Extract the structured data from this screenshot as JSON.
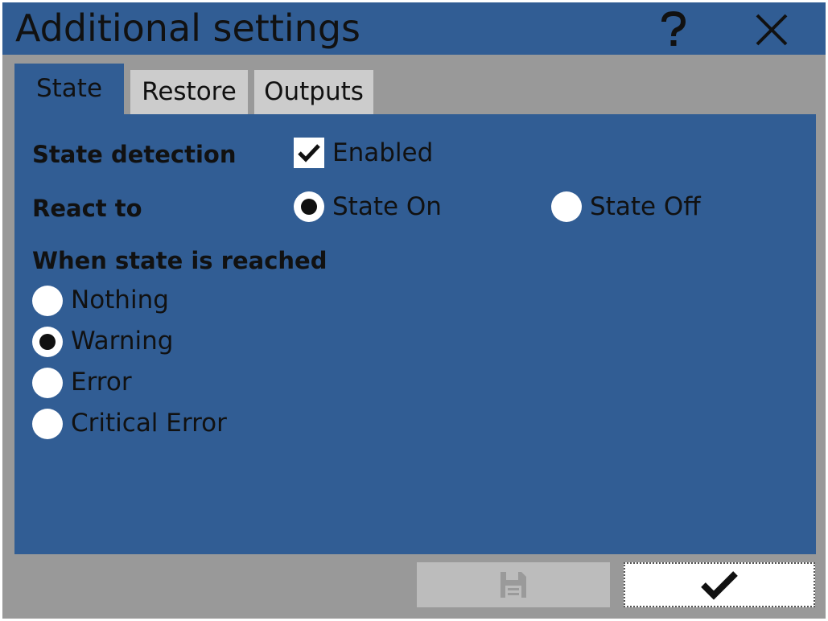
{
  "window": {
    "title": "Additional settings",
    "help_icon": "question-mark-icon",
    "close_icon": "close-x-icon"
  },
  "tabs": [
    {
      "label": "State",
      "active": true
    },
    {
      "label": "Restore",
      "active": false
    },
    {
      "label": "Outputs",
      "active": false
    }
  ],
  "state_tab": {
    "state_detection": {
      "label": "State detection",
      "checkbox_label": "Enabled",
      "checked": true
    },
    "react_to": {
      "label": "React to",
      "options": [
        {
          "label": "State On",
          "selected": true
        },
        {
          "label": "State Off",
          "selected": false
        }
      ]
    },
    "when_reached": {
      "label": "When state is reached",
      "options": [
        {
          "label": "Nothing",
          "selected": false
        },
        {
          "label": "Warning",
          "selected": true
        },
        {
          "label": "Error",
          "selected": false
        },
        {
          "label": "Critical Error",
          "selected": false
        }
      ]
    }
  },
  "footer": {
    "save_icon": "floppy-disk-icon",
    "save_enabled": false,
    "ok_icon": "checkmark-icon"
  },
  "colors": {
    "title_bar": "#315d94",
    "panel": "#315d94",
    "background": "#999999",
    "inactive_tab": "#cccccc",
    "disabled_button": "#bcbcbc"
  }
}
